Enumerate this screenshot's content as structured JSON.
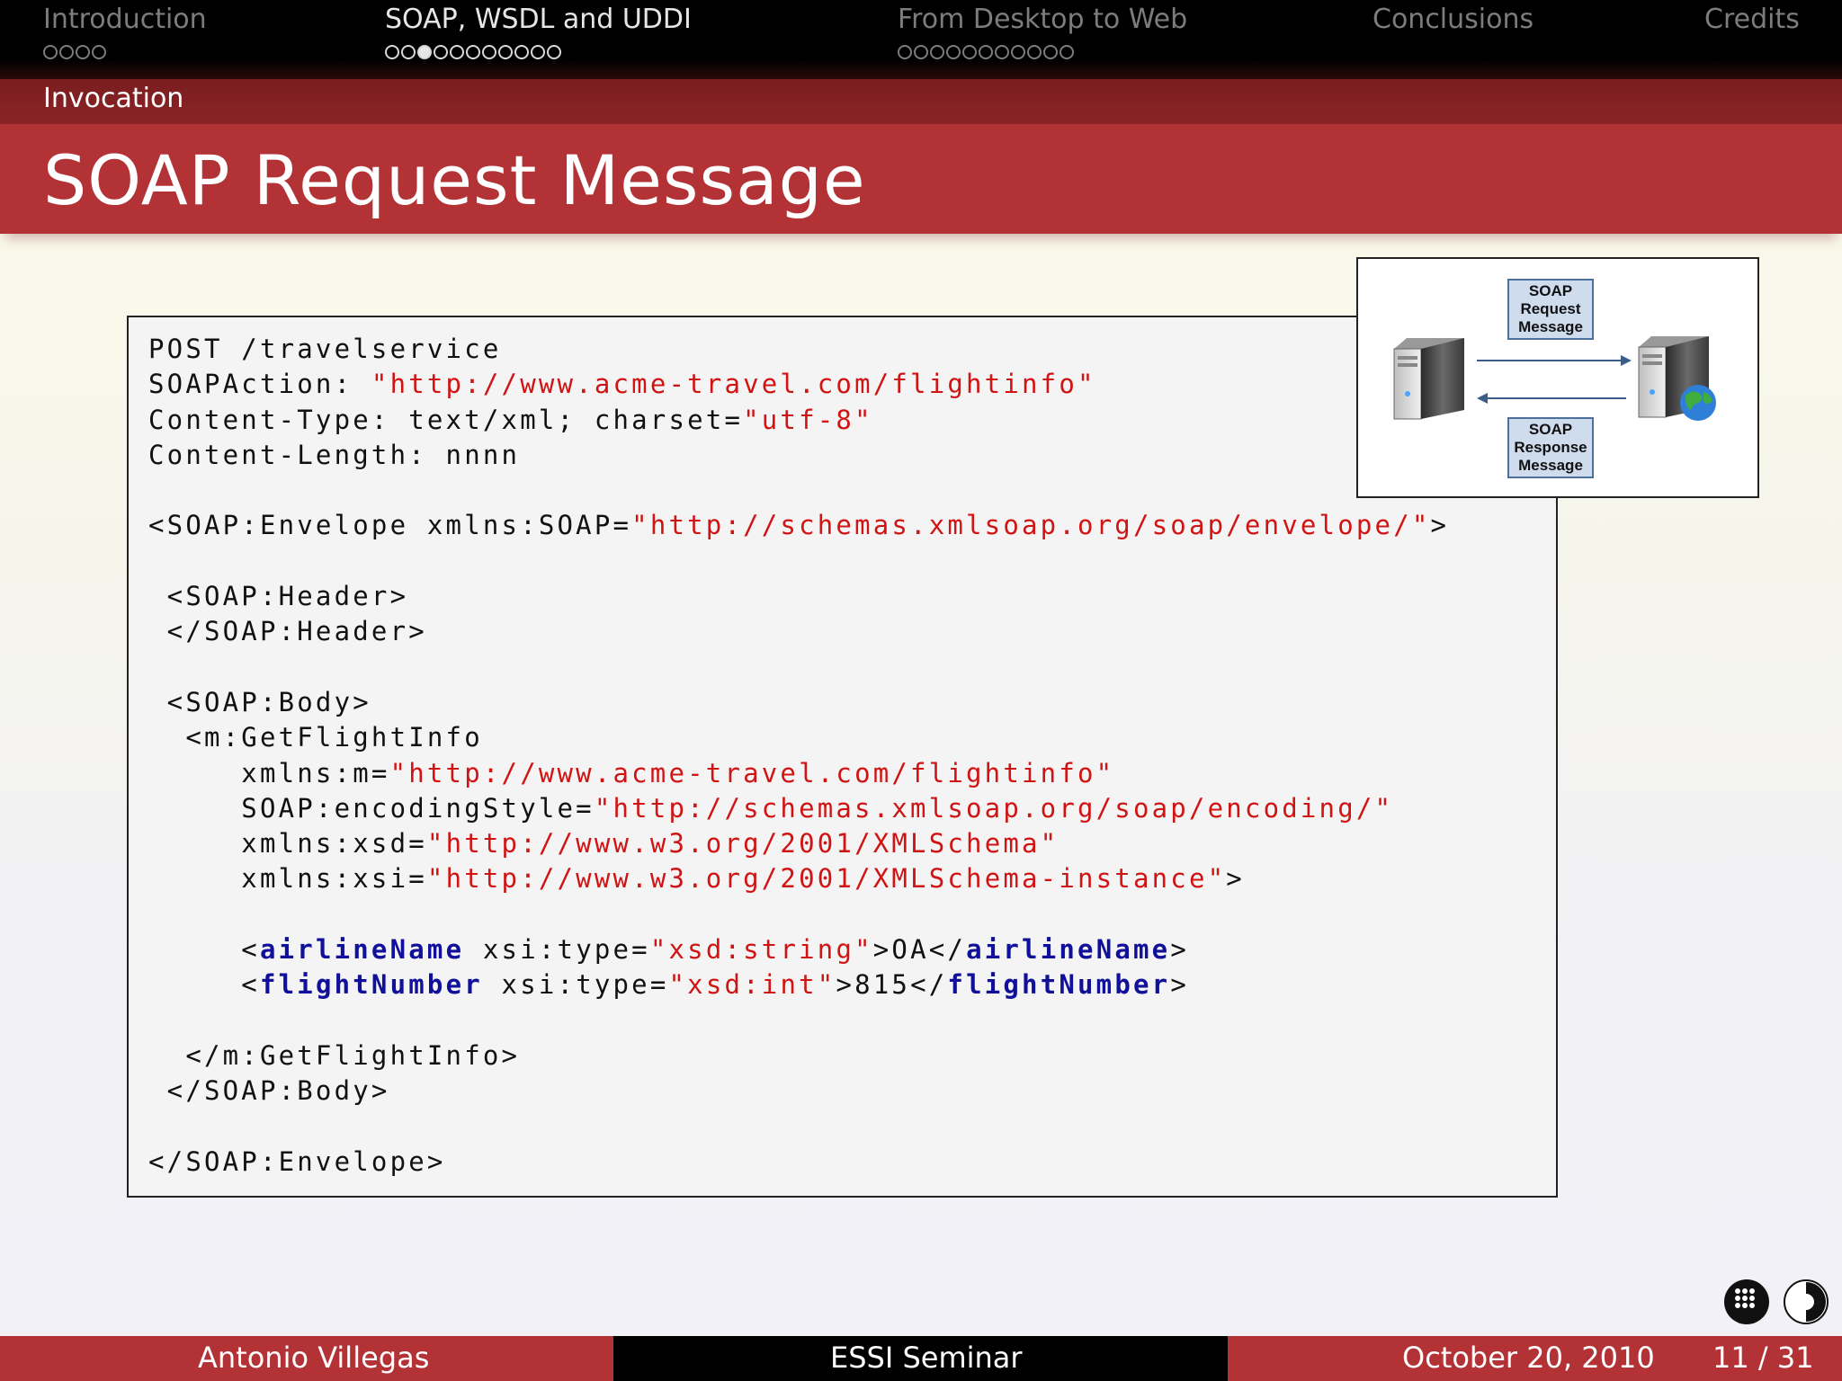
{
  "nav": {
    "sections": [
      {
        "label": "Introduction",
        "dots": 4,
        "filled": -1,
        "active": false
      },
      {
        "label": "SOAP, WSDL and UDDI",
        "dots": 11,
        "filled": 2,
        "active": true
      },
      {
        "label": "From Desktop to Web",
        "dots": 11,
        "filled": -1,
        "active": false
      },
      {
        "label": "Conclusions",
        "dots": 0,
        "filled": -1,
        "active": false
      },
      {
        "label": "Credits",
        "dots": 0,
        "filled": -1,
        "active": false
      }
    ]
  },
  "subsection": "Invocation",
  "title": "SOAP Request Message",
  "code": {
    "lines": [
      [
        {
          "t": "POST /travelservice"
        }
      ],
      [
        {
          "t": "SOAPAction: "
        },
        {
          "t": "\"http://www.acme-travel.com/flightinfo\"",
          "c": "str"
        }
      ],
      [
        {
          "t": "Content-Type: text/xml; charset="
        },
        {
          "t": "\"utf-8\"",
          "c": "str"
        }
      ],
      [
        {
          "t": "Content-Length: nnnn"
        }
      ],
      [],
      [
        {
          "t": "<SOAP:Envelope xmlns:SOAP="
        },
        {
          "t": "\"http://schemas.xmlsoap.org/soap/envelope/\"",
          "c": "str"
        },
        {
          "t": ">"
        }
      ],
      [],
      [
        {
          "t": " <SOAP:Header>"
        }
      ],
      [
        {
          "t": " </SOAP:Header>"
        }
      ],
      [],
      [
        {
          "t": " <SOAP:Body>"
        }
      ],
      [
        {
          "t": "  <m:GetFlightInfo"
        }
      ],
      [
        {
          "t": "     xmlns:m="
        },
        {
          "t": "\"http://www.acme-travel.com/flightinfo\"",
          "c": "str"
        }
      ],
      [
        {
          "t": "     SOAP:encodingStyle="
        },
        {
          "t": "\"http://schemas.xmlsoap.org/soap/encoding/\"",
          "c": "str"
        }
      ],
      [
        {
          "t": "     xmlns:xsd="
        },
        {
          "t": "\"http://www.w3.org/2001/XMLSchema\"",
          "c": "str"
        }
      ],
      [
        {
          "t": "     xmlns:xsi="
        },
        {
          "t": "\"http://www.w3.org/2001/XMLSchema-instance\"",
          "c": "str"
        },
        {
          "t": ">"
        }
      ],
      [],
      [
        {
          "t": "     <"
        },
        {
          "t": "airlineName",
          "c": "kw"
        },
        {
          "t": " xsi:type="
        },
        {
          "t": "\"xsd:string\"",
          "c": "str"
        },
        {
          "t": ">OA</"
        },
        {
          "t": "airlineName",
          "c": "kw"
        },
        {
          "t": ">"
        }
      ],
      [
        {
          "t": "     <"
        },
        {
          "t": "flightNumber",
          "c": "kw"
        },
        {
          "t": " xsi:type="
        },
        {
          "t": "\"xsd:int\"",
          "c": "str"
        },
        {
          "t": ">815</"
        },
        {
          "t": "flightNumber",
          "c": "kw"
        },
        {
          "t": ">"
        }
      ],
      [],
      [
        {
          "t": "  </m:GetFlightInfo>"
        }
      ],
      [
        {
          "t": " </SOAP:Body>"
        }
      ],
      [],
      [
        {
          "t": "</SOAP:Envelope>"
        }
      ]
    ]
  },
  "diagram": {
    "request_label": [
      "SOAP",
      "Request",
      "Message"
    ],
    "response_label": [
      "SOAP",
      "Response",
      "Message"
    ]
  },
  "footer": {
    "author": "Antonio Villegas",
    "event": "ESSI Seminar",
    "date": "October 20, 2010",
    "page": "11 / 31"
  },
  "colors": {
    "accent": "#b23236",
    "string": "#d01414",
    "keyword": "#10109a"
  }
}
